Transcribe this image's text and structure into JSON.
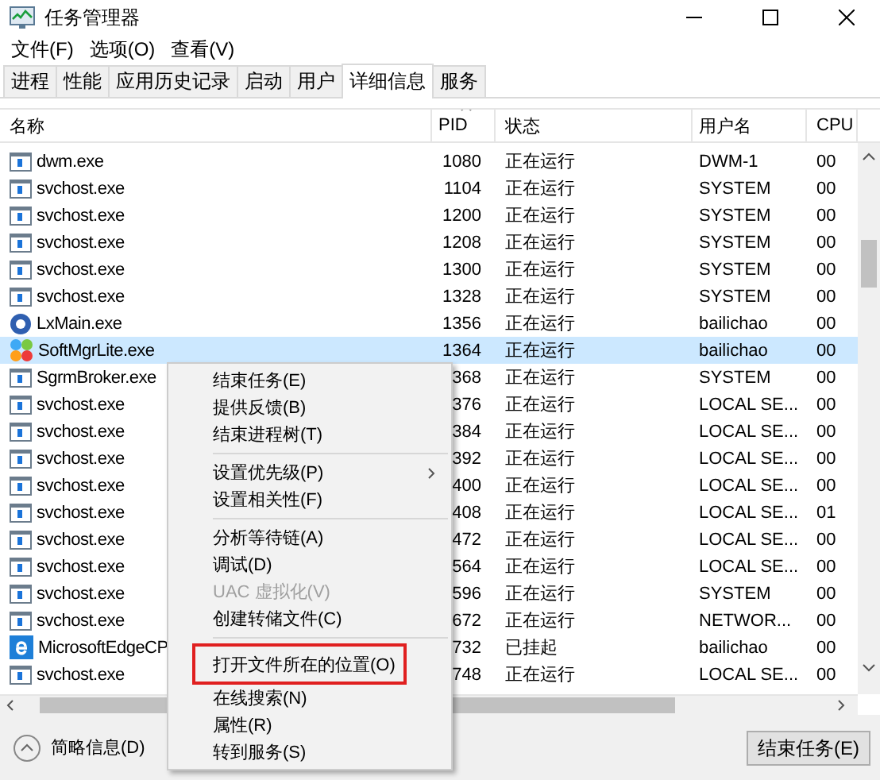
{
  "window": {
    "title": "任务管理器"
  },
  "menu_bar": [
    "文件(F)",
    "选项(O)",
    "查看(V)"
  ],
  "tabs": [
    {
      "label": "进程",
      "selected": false
    },
    {
      "label": "性能",
      "selected": false
    },
    {
      "label": "应用历史记录",
      "selected": false
    },
    {
      "label": "启动",
      "selected": false
    },
    {
      "label": "用户",
      "selected": false
    },
    {
      "label": "详细信息",
      "selected": true
    },
    {
      "label": "服务",
      "selected": false
    }
  ],
  "table": {
    "columns": [
      "名称",
      "PID",
      "状态",
      "用户名",
      "CPU"
    ],
    "rows": [
      {
        "kind": "app",
        "name": "dwm.exe",
        "pid": "1080",
        "status": "正在运行",
        "user": "DWM-1",
        "cpu": "00",
        "selected": false
      },
      {
        "kind": "app",
        "name": "svchost.exe",
        "pid": "1104",
        "status": "正在运行",
        "user": "SYSTEM",
        "cpu": "00",
        "selected": false
      },
      {
        "kind": "app",
        "name": "svchost.exe",
        "pid": "1200",
        "status": "正在运行",
        "user": "SYSTEM",
        "cpu": "00",
        "selected": false
      },
      {
        "kind": "app",
        "name": "svchost.exe",
        "pid": "1208",
        "status": "正在运行",
        "user": "SYSTEM",
        "cpu": "00",
        "selected": false
      },
      {
        "kind": "app",
        "name": "svchost.exe",
        "pid": "1300",
        "status": "正在运行",
        "user": "SYSTEM",
        "cpu": "00",
        "selected": false
      },
      {
        "kind": "app",
        "name": "svchost.exe",
        "pid": "1328",
        "status": "正在运行",
        "user": "SYSTEM",
        "cpu": "00",
        "selected": false
      },
      {
        "kind": "disc",
        "name": "LxMain.exe",
        "pid": "1356",
        "status": "正在运行",
        "user": "bailichao",
        "cpu": "00",
        "selected": false
      },
      {
        "kind": "blocks",
        "name": "SoftMgrLite.exe",
        "pid": "1364",
        "status": "正在运行",
        "user": "bailichao",
        "cpu": "00",
        "selected": true
      },
      {
        "kind": "app",
        "name": "SgrmBroker.exe",
        "pid": "368",
        "status": "正在运行",
        "user": "SYSTEM",
        "cpu": "00",
        "selected": false
      },
      {
        "kind": "app",
        "name": "svchost.exe",
        "pid": "376",
        "status": "正在运行",
        "user": "LOCAL SE...",
        "cpu": "00",
        "selected": false
      },
      {
        "kind": "app",
        "name": "svchost.exe",
        "pid": "384",
        "status": "正在运行",
        "user": "LOCAL SE...",
        "cpu": "00",
        "selected": false
      },
      {
        "kind": "app",
        "name": "svchost.exe",
        "pid": "392",
        "status": "正在运行",
        "user": "LOCAL SE...",
        "cpu": "00",
        "selected": false
      },
      {
        "kind": "app",
        "name": "svchost.exe",
        "pid": "400",
        "status": "正在运行",
        "user": "LOCAL SE...",
        "cpu": "00",
        "selected": false
      },
      {
        "kind": "app",
        "name": "svchost.exe",
        "pid": "408",
        "status": "正在运行",
        "user": "LOCAL SE...",
        "cpu": "01",
        "selected": false
      },
      {
        "kind": "app",
        "name": "svchost.exe",
        "pid": "472",
        "status": "正在运行",
        "user": "LOCAL SE...",
        "cpu": "00",
        "selected": false
      },
      {
        "kind": "app",
        "name": "svchost.exe",
        "pid": "564",
        "status": "正在运行",
        "user": "LOCAL SE...",
        "cpu": "00",
        "selected": false
      },
      {
        "kind": "app",
        "name": "svchost.exe",
        "pid": "596",
        "status": "正在运行",
        "user": "SYSTEM",
        "cpu": "00",
        "selected": false
      },
      {
        "kind": "app",
        "name": "svchost.exe",
        "pid": "672",
        "status": "正在运行",
        "user": "NETWOR...",
        "cpu": "00",
        "selected": false
      },
      {
        "kind": "edge",
        "name": "MicrosoftEdgeCP",
        "pid": "732",
        "status": "已挂起",
        "user": "bailichao",
        "cpu": "00",
        "selected": false
      },
      {
        "kind": "app",
        "name": "svchost.exe",
        "pid": "748",
        "status": "正在运行",
        "user": "LOCAL SE...",
        "cpu": "00",
        "selected": false
      }
    ]
  },
  "context_menu": [
    {
      "kind": "item",
      "label": "结束任务(E)",
      "disabled": false
    },
    {
      "kind": "item",
      "label": "提供反馈(B)",
      "disabled": false
    },
    {
      "kind": "item",
      "label": "结束进程树(T)",
      "disabled": false
    },
    {
      "kind": "separator"
    },
    {
      "kind": "submenu",
      "label": "设置优先级(P)",
      "disabled": false
    },
    {
      "kind": "item",
      "label": "设置相关性(F)",
      "disabled": false
    },
    {
      "kind": "separator"
    },
    {
      "kind": "item",
      "label": "分析等待链(A)",
      "disabled": false
    },
    {
      "kind": "item",
      "label": "调试(D)",
      "disabled": false
    },
    {
      "kind": "item",
      "label": "UAC 虚拟化(V)",
      "disabled": true
    },
    {
      "kind": "item",
      "label": "创建转储文件(C)",
      "disabled": false
    },
    {
      "kind": "separator"
    },
    {
      "kind": "highlighted",
      "label": "打开文件所在的位置(O)",
      "disabled": false
    },
    {
      "kind": "item",
      "label": "在线搜索(N)",
      "disabled": false
    },
    {
      "kind": "item",
      "label": "属性(R)",
      "disabled": false
    },
    {
      "kind": "item",
      "label": "转到服务(S)",
      "disabled": false
    }
  ],
  "footer": {
    "details_toggle": "简略信息(D)",
    "end_task_button": "结束任务(E)"
  }
}
